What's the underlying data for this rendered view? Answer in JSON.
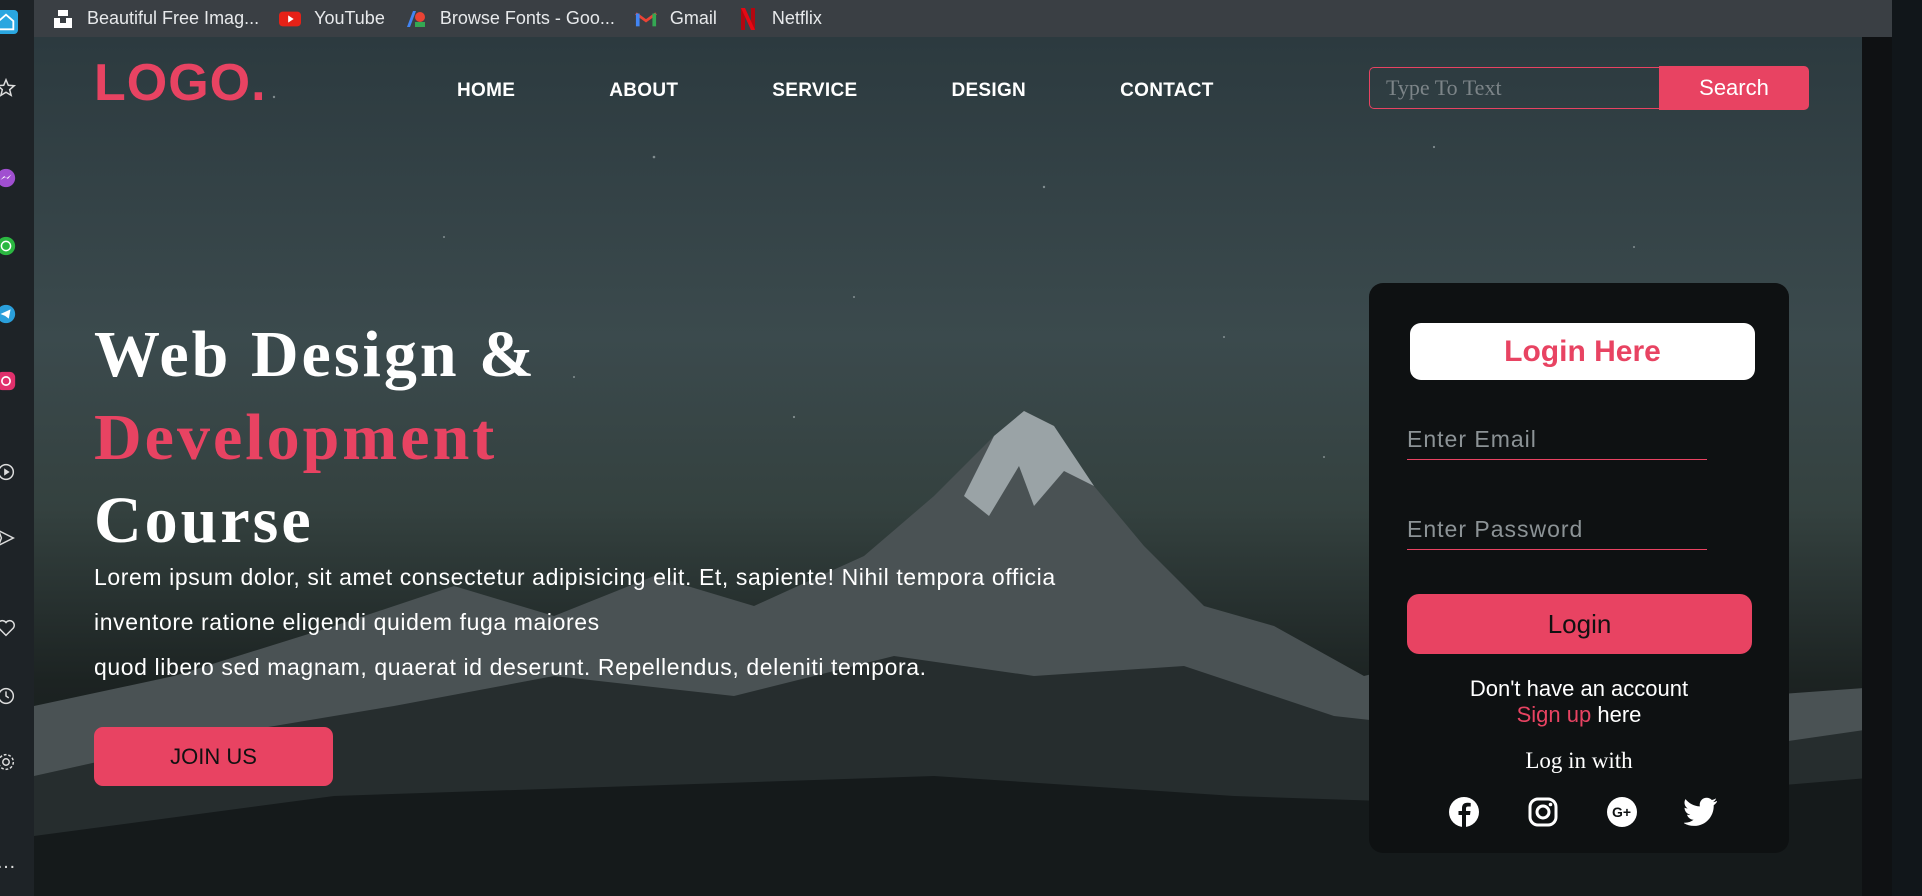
{
  "bookmarks": [
    {
      "label": "Beautiful Free Imag...",
      "icon": "unsplash-icon"
    },
    {
      "label": "YouTube",
      "icon": "youtube-icon"
    },
    {
      "label": "Browse Fonts - Goo...",
      "icon": "google-fonts-icon"
    },
    {
      "label": "Gmail",
      "icon": "gmail-icon"
    },
    {
      "label": "Netflix",
      "icon": "netflix-icon"
    }
  ],
  "header": {
    "logo": "LOGO.",
    "nav": [
      "HOME",
      "ABOUT",
      "SERVICE",
      "DESIGN",
      "CONTACT"
    ],
    "search_placeholder": "Type To Text",
    "search_label": "Search"
  },
  "hero": {
    "line1": "Web Design &",
    "line2": "Development",
    "line3": "Course",
    "paragraph": [
      "Lorem ipsum dolor, sit amet consectetur adipisicing elit. Et, sapiente! Nihil tempora officia",
      "inventore ratione eligendi quidem fuga maiores",
      "quod libero sed magnam, quaerat id deserunt. Repellendus, deleniti tempora."
    ],
    "cta": "JOIN US"
  },
  "login": {
    "title": "Login Here",
    "email_placeholder": "Enter Email",
    "password_placeholder": "Enter Password",
    "button": "Login",
    "no_account": "Don't have an account",
    "signup": "Sign up",
    "here": " here",
    "login_with": "Log in with",
    "socials": [
      "facebook-icon",
      "instagram-icon",
      "google-plus-icon",
      "twitter-icon"
    ]
  },
  "colors": {
    "accent": "#e84362",
    "card_bg": "#0e1112",
    "text": "#ffffff"
  }
}
